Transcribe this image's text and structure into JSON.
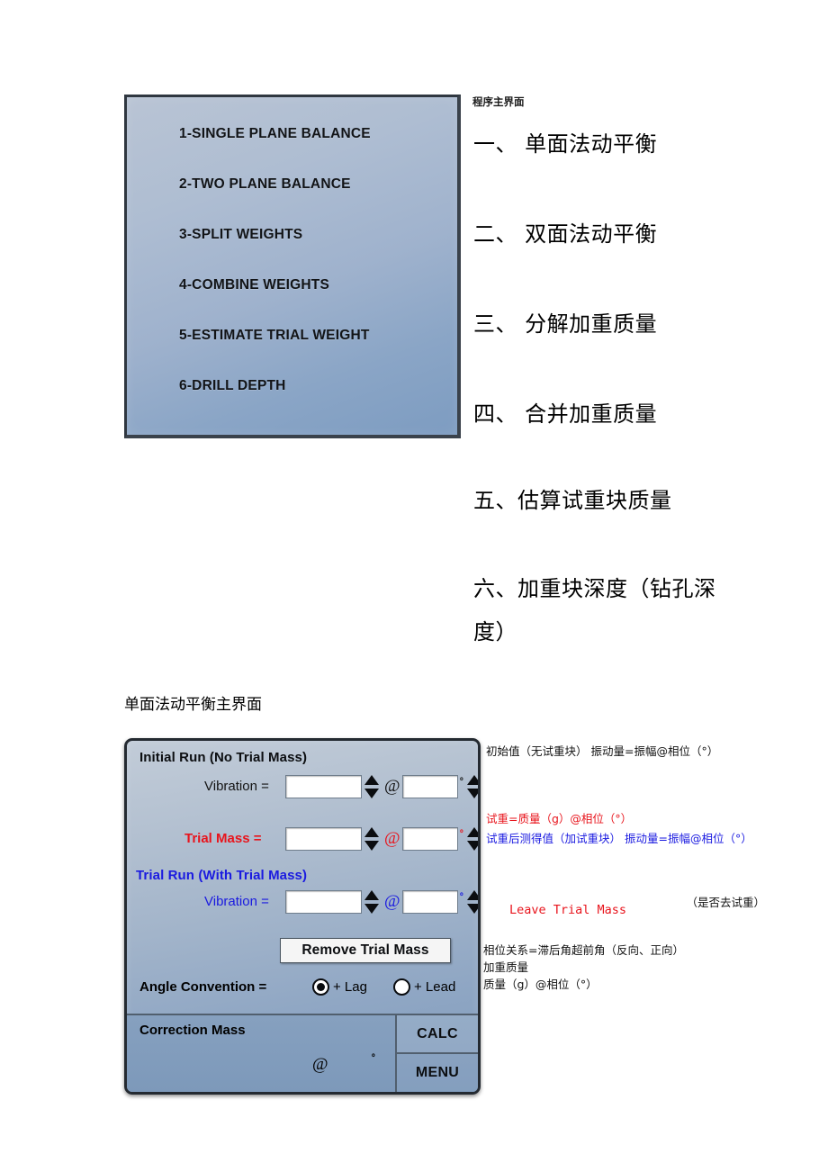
{
  "section1": {
    "caption": "程序主界面",
    "menu_items": [
      "1-SINGLE PLANE BALANCE",
      "2-TWO PLANE BALANCE",
      "3-SPLIT WEIGHTS",
      "4-COMBINE WEIGHTS",
      "5-ESTIMATE TRIAL WEIGHT",
      "6-DRILL DEPTH"
    ],
    "annotations": [
      "一、   单面法动平衡",
      "二、   双面法动平衡",
      "三、   分解加重质量",
      "四、   合并加重质量",
      "五、估算试重块质量",
      "六、加重块深度（钻孔深度）"
    ]
  },
  "section2": {
    "caption": "单面法动平衡主界面",
    "ui": {
      "initial_run_title": "Initial Run (No Trial Mass)",
      "initial_vibration_label": "Vibration =",
      "initial_amplitude_value": "",
      "initial_phase_value": "",
      "trial_mass_label": "Trial Mass =",
      "trial_mass_value": "",
      "trial_mass_phase_value": "",
      "trial_run_title": "Trial Run (With Trial Mass)",
      "trial_vibration_label": "Vibration =",
      "trial_amplitude_value": "",
      "trial_phase_value": "",
      "remove_trial_mass_label": "Remove Trial Mass",
      "angle_convention_label": "Angle Convention =",
      "angle_option_lag": "+ Lag",
      "angle_option_lead": "+ Lead",
      "angle_selected": "+ Lag",
      "correction_mass_label": "Correction Mass",
      "correction_at_symbol": "@",
      "correction_degree_symbol": "º",
      "at_symbol": "@",
      "degree_symbol": "º",
      "calc_button": "CALC",
      "menu_button": "MENU"
    },
    "notes": {
      "initial": "初始值（无试重块） 振动量=振幅@相位（°）",
      "trial_mass": "试重=质量（g）@相位（°）",
      "trial_run": "试重后测得值（加试重块） 振动量=振幅@相位（°）",
      "leave_trial_mass": "Leave Trial Mass",
      "leave_trial_mass_cn": "（是否去试重）",
      "phase_relation": "相位关系=滞后角超前角（反向、正向）\n加重质量\n质量（g）@相位（°）"
    }
  },
  "colors": {
    "red": "#e8141c",
    "blue": "#1a1ae0",
    "panel_top": "#c2ccd8",
    "panel_bottom": "#7f9bbd"
  }
}
